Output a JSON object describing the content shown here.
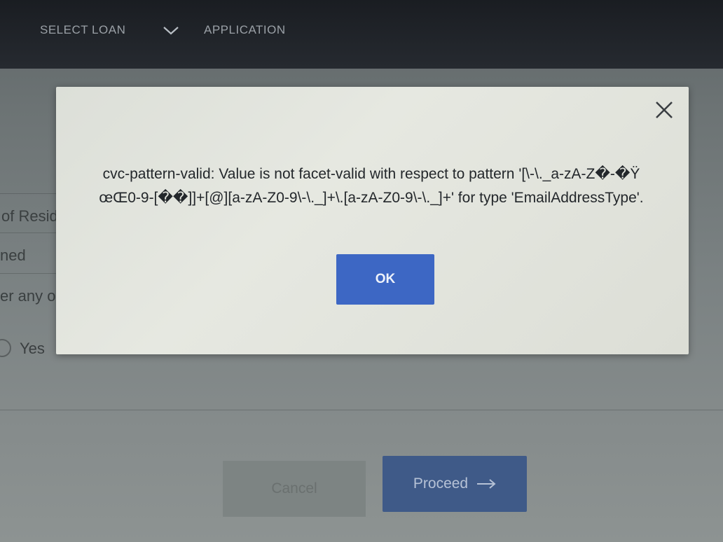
{
  "stepper": {
    "step1": "SELECT LOAN",
    "step2": "APPLICATION"
  },
  "form": {
    "label_residence": "of Resid",
    "label_owned": "ned",
    "label_any": "er any o",
    "option_yes": "Yes"
  },
  "buttons": {
    "cancel": "Cancel",
    "proceed": "Proceed"
  },
  "dialog": {
    "message": "cvc-pattern-valid: Value is not facet-valid with respect to pattern '[\\-\\._a-zA-Z�-�ŸœŒ0-9-[��]]+[@][a-zA-Z0-9\\-\\._]+\\.[a-zA-Z0-9\\-\\._]+' for type 'EmailAddressType'.",
    "ok": "OK"
  },
  "colors": {
    "ok_button": "#3d67c4",
    "proceed_button": "#3f5a88",
    "dialog_bg": "#e4e6df",
    "topbar": "#1e2126"
  }
}
